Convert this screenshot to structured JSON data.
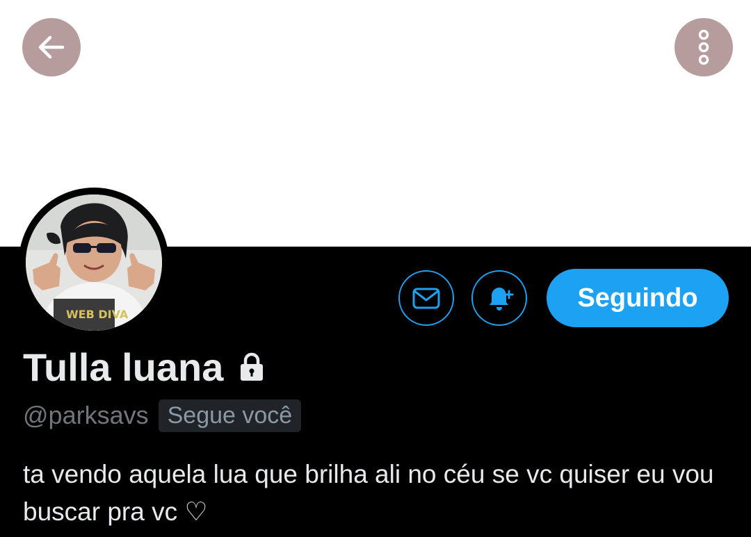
{
  "header": {
    "back_icon": "arrow-left-icon",
    "more_icon": "more-vertical-icon",
    "button_color": "#b69c9c"
  },
  "profile": {
    "name": "Tulla luana",
    "protected_icon": "lock-icon",
    "handle": "@parksavs",
    "follows_you_label": "Segue você",
    "bio": "ta vendo aquela lua que brilha ali no céu se vc quiser eu vou buscar pra vc ♡"
  },
  "actions": {
    "message_icon": "mail-icon",
    "notify_icon": "bell-plus-icon",
    "follow_label": "Seguindo",
    "accent_color": "#1da1f2"
  }
}
